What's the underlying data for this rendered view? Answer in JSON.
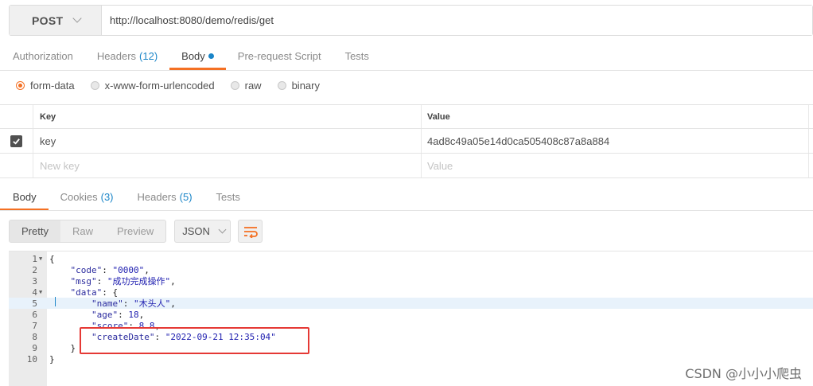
{
  "request": {
    "method": "POST",
    "url": "http://localhost:8080/demo/redis/get"
  },
  "request_tabs": [
    {
      "label": "Authorization",
      "count": "",
      "active": false
    },
    {
      "label": "Headers",
      "count": "(12)",
      "active": false
    },
    {
      "label": "Body",
      "count": "",
      "active": true
    },
    {
      "label": "Pre-request Script",
      "count": "",
      "active": false
    },
    {
      "label": "Tests",
      "count": "",
      "active": false
    }
  ],
  "body_types": [
    {
      "label": "form-data",
      "checked": true
    },
    {
      "label": "x-www-form-urlencoded",
      "checked": false
    },
    {
      "label": "raw",
      "checked": false
    },
    {
      "label": "binary",
      "checked": false
    }
  ],
  "params": {
    "key_header": "Key",
    "value_header": "Value",
    "rows": [
      {
        "key": "key",
        "value": "4ad8c49a05e14d0ca505408c87a8a884",
        "checked": true
      }
    ],
    "new_key_placeholder": "New key",
    "new_value_placeholder": "Value"
  },
  "response_tabs": [
    {
      "label": "Body",
      "count": "",
      "active": true
    },
    {
      "label": "Cookies",
      "count": "(3)",
      "active": false
    },
    {
      "label": "Headers",
      "count": "(5)",
      "active": false
    },
    {
      "label": "Tests",
      "count": "",
      "active": false
    }
  ],
  "view_modes": [
    "Pretty",
    "Raw",
    "Preview"
  ],
  "selected_view": "Pretty",
  "format": "JSON",
  "code_lines": [
    {
      "n": "1",
      "fold": true,
      "text": "{"
    },
    {
      "n": "2",
      "fold": false,
      "text": "    \"code\": \"0000\","
    },
    {
      "n": "3",
      "fold": false,
      "text": "    \"msg\": \"成功完成操作\","
    },
    {
      "n": "4",
      "fold": true,
      "text": "    \"data\": {"
    },
    {
      "n": "5",
      "fold": false,
      "text": "        \"name\": \"木头人\","
    },
    {
      "n": "6",
      "fold": false,
      "text": "        \"age\": 18,"
    },
    {
      "n": "7",
      "fold": false,
      "text": "        \"score\": 8.8,"
    },
    {
      "n": "8",
      "fold": false,
      "text": "        \"createDate\": \"2022-09-21 12:35:04\""
    },
    {
      "n": "9",
      "fold": false,
      "text": "    }"
    },
    {
      "n": "10",
      "fold": false,
      "text": "}"
    }
  ],
  "highlighted_line": "5",
  "watermark": "CSDN @小小小爬虫",
  "colors": {
    "accent": "#f47023",
    "count_blue": "#1a85c8",
    "annotation_red": "#e53935"
  }
}
